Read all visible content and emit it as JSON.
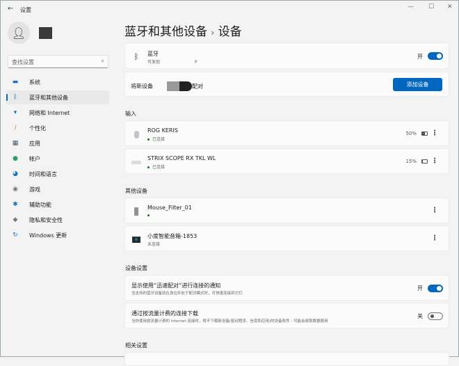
{
  "window": {
    "title": "设置",
    "back_icon": "←",
    "minimize": "—",
    "maximize": "☐",
    "close": "✕"
  },
  "search": {
    "placeholder": "查找设置",
    "icon": "⌕"
  },
  "sidebar": {
    "items": [
      {
        "label": "系统",
        "icon": "monitor",
        "color": "#1a6fc4"
      },
      {
        "label": "蓝牙和其他设备",
        "icon": "bluetooth",
        "color": "#0067c0"
      },
      {
        "label": "网络和 Internet",
        "icon": "wifi",
        "color": "#1a6fc4"
      },
      {
        "label": "个性化",
        "icon": "brush",
        "color": "#e07b39"
      },
      {
        "label": "应用",
        "icon": "apps",
        "color": "#4a5a70"
      },
      {
        "label": "帐户",
        "icon": "person",
        "color": "#2e9e6a"
      },
      {
        "label": "时间和语言",
        "icon": "globe",
        "color": "#1a6fc4"
      },
      {
        "label": "游戏",
        "icon": "gamepad",
        "color": "#777"
      },
      {
        "label": "辅助功能",
        "icon": "accessibility",
        "color": "#1a6fc4"
      },
      {
        "label": "隐私和安全性",
        "icon": "shield",
        "color": "#777"
      },
      {
        "label": "Windows 更新",
        "icon": "update",
        "color": "#1a6fc4"
      }
    ],
    "active": 1
  },
  "header": {
    "parent": "蓝牙和其他设备",
    "sep": "›",
    "current": "设备"
  },
  "bluetooth": {
    "title": "蓝牙",
    "subtitle": "可发现",
    "subtitle_tail": "P",
    "state": "开"
  },
  "pair": {
    "text": "将新设备",
    "text_tail": "配对",
    "button": "添加设备"
  },
  "sections": {
    "input": "输入",
    "other": "其他设备",
    "device_settings": "设备设置",
    "related": "相关设置"
  },
  "input_devices": [
    {
      "name": "ROG KERIS",
      "status": "已连接",
      "battery": "50%",
      "battery_level": 50
    },
    {
      "name": "STRIX SCOPE RX TKL WL",
      "status": "已连接",
      "battery": "15%",
      "battery_level": 15
    }
  ],
  "other_devices": [
    {
      "name": "Mouse_Filter_01",
      "status": ""
    },
    {
      "name": "小度智能音箱-1853",
      "status": "未连接"
    }
  ],
  "settings": [
    {
      "title": "显示使用“迅速配对”进行连接的通知",
      "desc": "当支持的蓝牙设备就在身边并处于配对模式时，可快速连接到它们",
      "state": "开",
      "on": true
    },
    {
      "title": "通过按流量计费的连接下载",
      "desc": "当你使用按流量计费的 Internet 连接时，将不下载新设备(驱动程序、信息和应用)的设备软件 - 可能会收取数据费用",
      "state": "关",
      "on": false
    }
  ],
  "more_icon": "⋮"
}
